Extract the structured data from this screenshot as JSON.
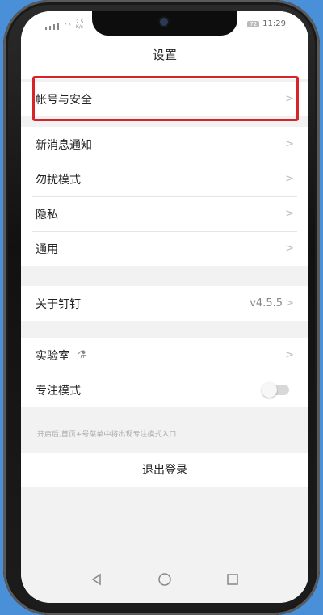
{
  "status": {
    "network_top": "2.5",
    "network_bottom": "K/s",
    "battery": "72",
    "time": "11:29"
  },
  "header": {
    "title": "设置"
  },
  "section1": {
    "account_security": "帐号与安全"
  },
  "section2": {
    "notifications": "新消息通知",
    "do_not_disturb": "勿扰模式",
    "privacy": "隐私",
    "general": "通用"
  },
  "section3": {
    "about": "关于钉钉",
    "version": "v4.5.5"
  },
  "section4": {
    "lab": "实验室",
    "focus_mode": "专注模式",
    "focus_mode_on": false
  },
  "hint": "开启后,首页+号菜单中将出现专注模式入口",
  "logout": "退出登录",
  "colors": {
    "highlight": "#d8232a",
    "background": "#f2f2f2",
    "phone_frame": "#111111"
  },
  "icons": {
    "chevron": "chevron-right-icon",
    "lab": "flask-icon",
    "nav_back": "triangle-back-icon",
    "nav_home": "circle-home-icon",
    "nav_recent": "square-recent-icon"
  }
}
